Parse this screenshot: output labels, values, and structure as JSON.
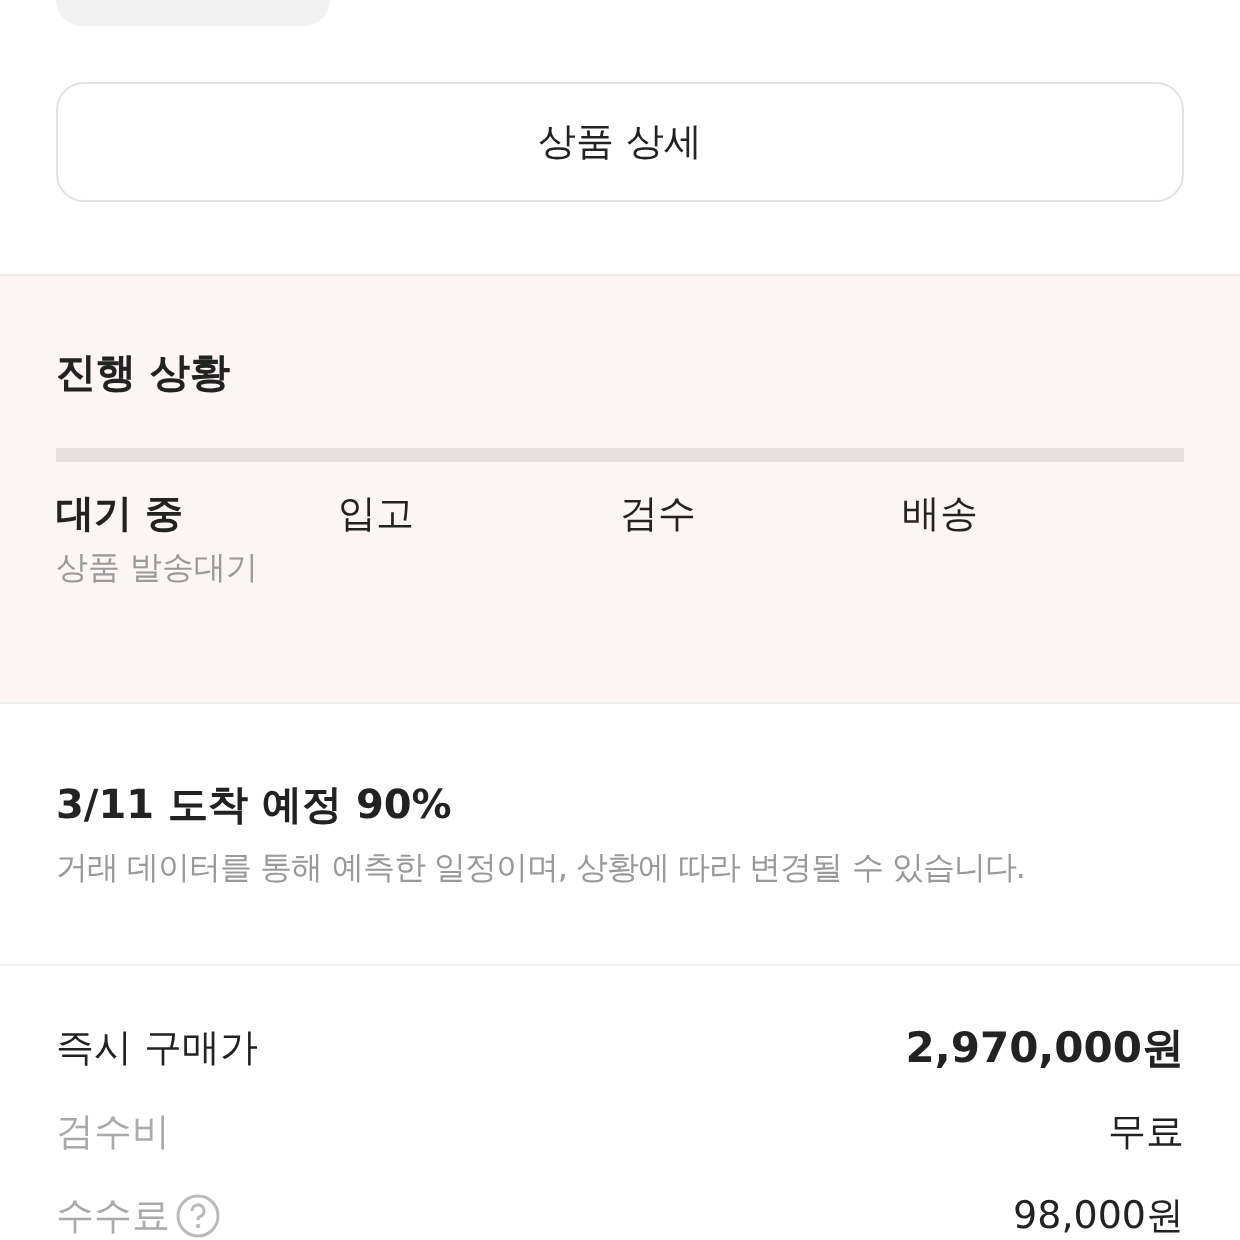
{
  "product_detail_button": "상품 상세",
  "progress": {
    "title": "진행 상황",
    "steps": [
      {
        "label": "대기 중",
        "selected": true,
        "note": "상품 발송대기"
      },
      {
        "label": "입고",
        "selected": false
      },
      {
        "label": "검수",
        "selected": false
      },
      {
        "label": "배송",
        "selected": false
      }
    ]
  },
  "estimate": {
    "title": "3/11 도착 예정 90%",
    "description": "거래 데이터를 통해 예측한 일정이며, 상황에 따라 변경될 수 있습니다."
  },
  "price_rows": [
    {
      "label": "즉시 구매가",
      "value": "2,970,000원",
      "kind": "total"
    },
    {
      "label": "검수비",
      "value": "무료",
      "kind": "fee"
    },
    {
      "label": "수수료",
      "value": "98,000원",
      "kind": "fee_help"
    }
  ]
}
